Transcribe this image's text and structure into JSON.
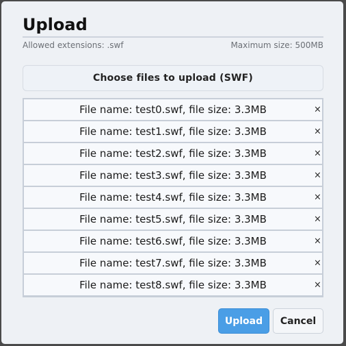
{
  "dialog": {
    "title": "Upload",
    "allowed_extensions": "Allowed extensions: .swf",
    "max_size": "Maximum size: 500MB",
    "choose_label": "Choose files to upload (SWF)",
    "upload_label": "Upload",
    "cancel_label": "Cancel"
  },
  "files": [
    {
      "text": "File name: test0.swf, file size: 3.3MB",
      "remove": "×"
    },
    {
      "text": "File name: test1.swf, file size: 3.3MB",
      "remove": "×"
    },
    {
      "text": "File name: test2.swf, file size: 3.3MB",
      "remove": "×"
    },
    {
      "text": "File name: test3.swf, file size: 3.3MB",
      "remove": "×"
    },
    {
      "text": "File name: test4.swf, file size: 3.3MB",
      "remove": "×"
    },
    {
      "text": "File name: test5.swf, file size: 3.3MB",
      "remove": "×"
    },
    {
      "text": "File name: test6.swf, file size: 3.3MB",
      "remove": "×"
    },
    {
      "text": "File name: test7.swf, file size: 3.3MB",
      "remove": "×"
    },
    {
      "text": "File name: test8.swf, file size: 3.3MB",
      "remove": "×"
    }
  ],
  "colors": {
    "accent": "#4a9ee6",
    "dialog_bg": "#eef1f5",
    "backdrop": "#4a4a4a"
  }
}
